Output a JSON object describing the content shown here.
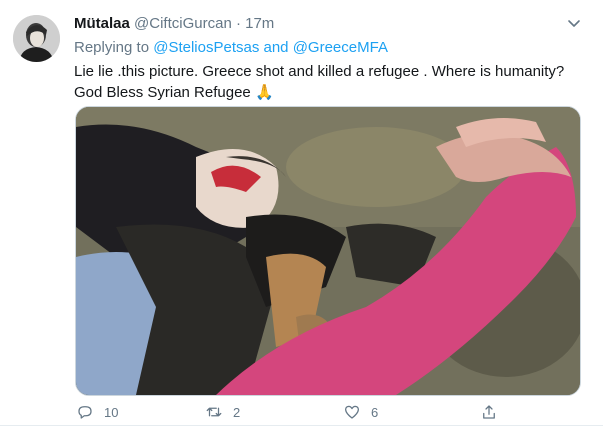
{
  "tweet": {
    "author": {
      "name": "Mütalaa",
      "handle": "@CiftciGurcan",
      "separator": "·",
      "time": "17m",
      "avatar_icon": "avatar-photo"
    },
    "reply": {
      "prefix": "Replying to",
      "mention1": "@SteliosPetsas",
      "conjunction": "and",
      "mention2": "@GreeceMFA"
    },
    "text_line1": "Lie lie .this picture. Greece shot and killed a refugee . Where is humanity?",
    "text_line2": "God Bless Syrian Refugee",
    "emoji": "🙏",
    "media_description_icon": "video-still-image",
    "actions": {
      "reply_count": "10",
      "retweet_count": "2",
      "like_count": "6",
      "reply_icon": "reply-icon",
      "retweet_icon": "retweet-icon",
      "like_icon": "heart-icon",
      "share_icon": "share-icon"
    },
    "colors": {
      "link": "#1da1f2",
      "meta": "#657786",
      "text": "#14171a"
    }
  }
}
